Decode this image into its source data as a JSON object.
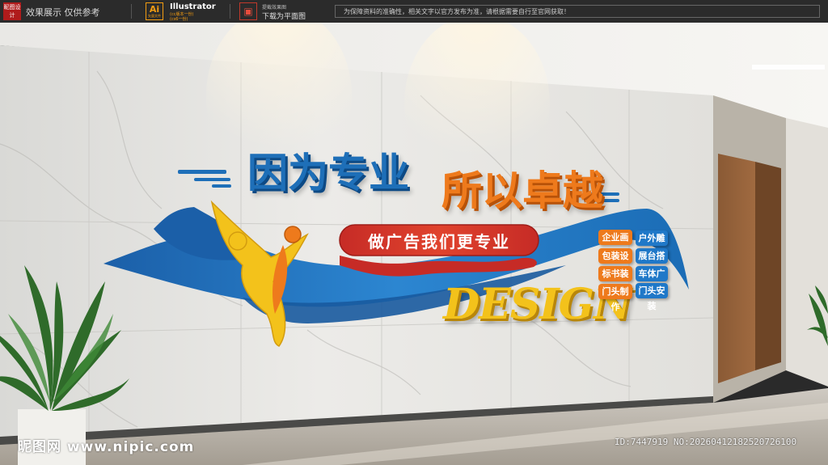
{
  "banner": {
    "logo_text": "昵图设计",
    "tag": "效果展示 仅供参考",
    "ai_label": "Ai",
    "ai_sub": "矢量文件",
    "software": "Illustrator",
    "version_line1": "(cc版本一份)",
    "version_line2": "(cs6一份)",
    "image_caption_small": "提截效果图",
    "image_caption": "下载为平面图",
    "notice": "为保障资料的准确性，相关文字以官方发布为准，请根据需要自行至官网获取！"
  },
  "sign": {
    "headline_left": "因为专业",
    "headline_right": "所以卓越",
    "slogan": "做广告我们更专业",
    "design": "DESIGN",
    "services_left": [
      "企业画册",
      "包装设计",
      "标书装订",
      "门头制作"
    ],
    "services_right": [
      "户外雕塑",
      "展台搭建",
      "车体广告",
      "门头安装"
    ]
  },
  "watermark": {
    "site": "昵图网 www.nipic.com",
    "id": "ID:7447919 NO:20260412182520726100"
  },
  "colors": {
    "brand_blue": "#1e6fb8",
    "brand_orange": "#ee7a1c",
    "brand_yellow": "#f3c21b",
    "slogan_red": "#d3352a"
  }
}
